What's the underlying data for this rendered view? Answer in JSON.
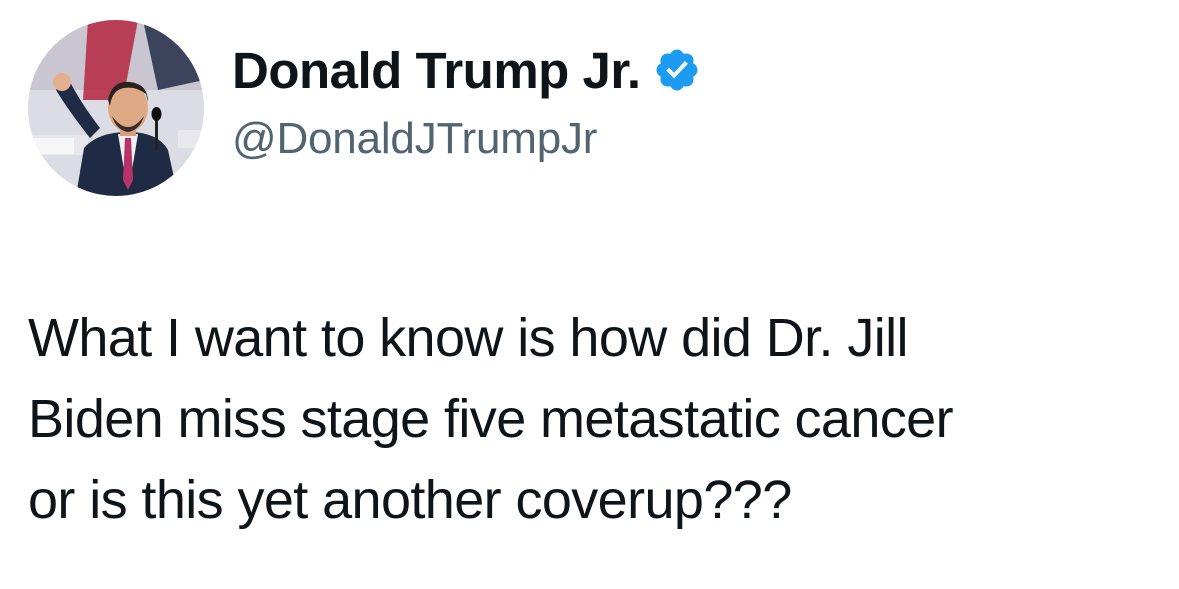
{
  "author": {
    "display_name": "Donald Trump Jr.",
    "handle": "@DonaldJTrumpJr",
    "verified": true,
    "verified_color": "#1d9bf0",
    "avatar_icon": "profile-photo"
  },
  "tweet": {
    "lines": [
      "What I want to know is how did Dr. Jill",
      "Biden miss stage five metastatic cancer",
      "or is this yet another coverup???"
    ]
  }
}
